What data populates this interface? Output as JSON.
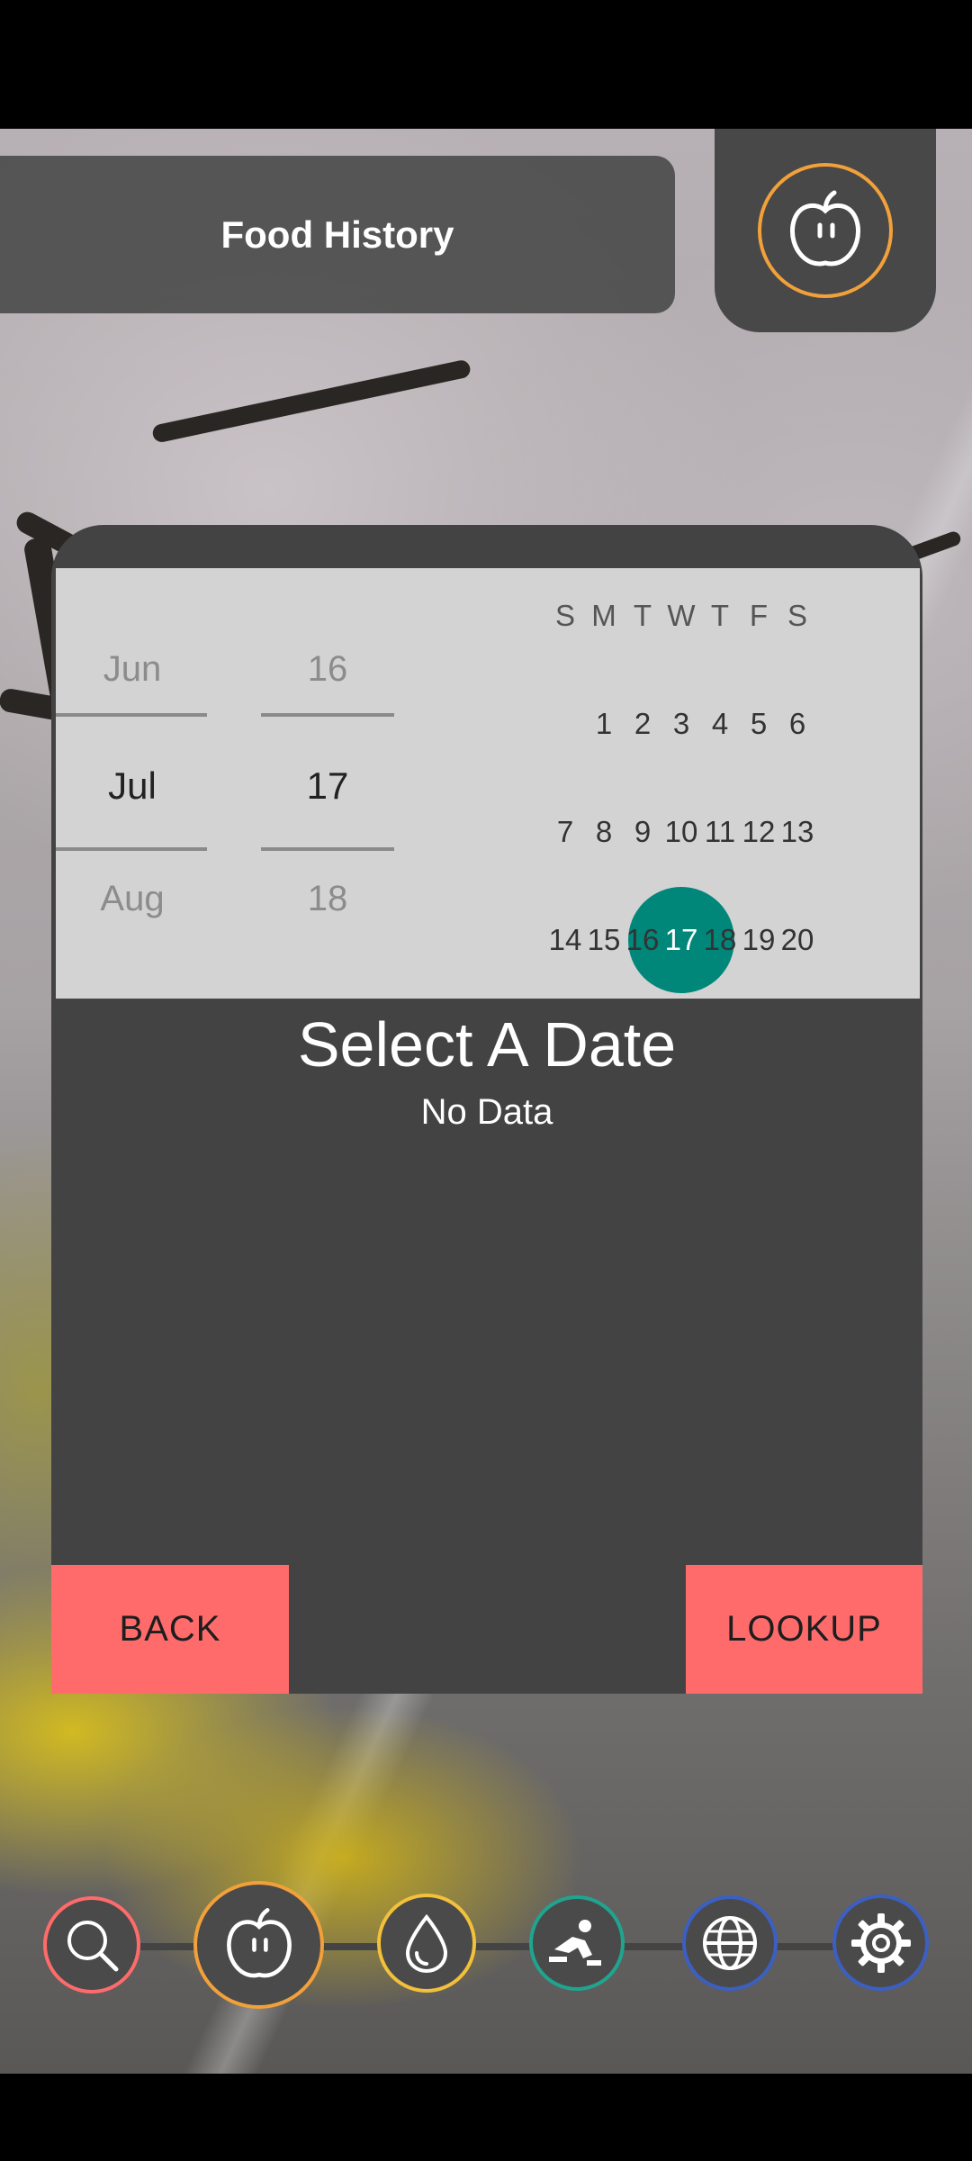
{
  "header": {
    "title": "Food History",
    "apple_icon": "apple-icon"
  },
  "picker": {
    "months": {
      "prev": "Jun",
      "selected": "Jul",
      "next": "Aug"
    },
    "days": {
      "prev": "16",
      "selected": "17",
      "next": "18"
    }
  },
  "calendar": {
    "weekdays": [
      "S",
      "M",
      "T",
      "W",
      "T",
      "F",
      "S"
    ],
    "rows": [
      [
        "",
        "1",
        "2",
        "3",
        "4",
        "5",
        "6"
      ],
      [
        "7",
        "8",
        "9",
        "10",
        "11",
        "12",
        "13"
      ],
      [
        "14",
        "15",
        "16",
        "17",
        "18",
        "19",
        "20"
      ]
    ],
    "selected_day": "17",
    "selected_color": "#00877a"
  },
  "content": {
    "heading": "Select A Date",
    "status": "No Data"
  },
  "buttons": {
    "back": "BACK",
    "lookup": "LOOKUP",
    "color": "#ff6b6b"
  },
  "nav": [
    {
      "icon": "search-icon",
      "ring": "#ff6b6b"
    },
    {
      "icon": "apple-icon",
      "ring": "#f2a13a",
      "active": true
    },
    {
      "icon": "water-drop-icon",
      "ring": "#f2c03a"
    },
    {
      "icon": "exercise-icon",
      "ring": "#1fa58f"
    },
    {
      "icon": "globe-icon",
      "ring": "#3b5fc2"
    },
    {
      "icon": "gear-icon",
      "ring": "#3b5fc2"
    }
  ]
}
